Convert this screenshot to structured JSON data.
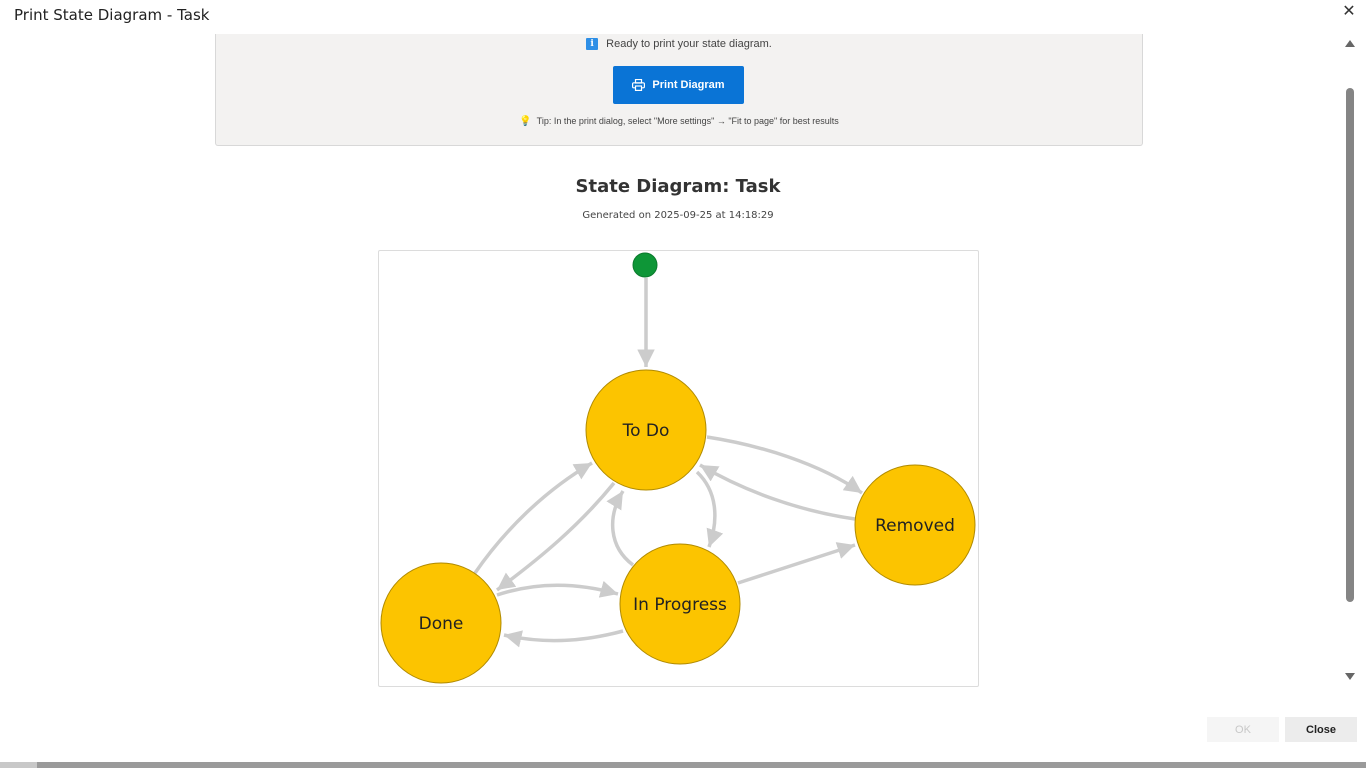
{
  "window": {
    "title": "Print State Diagram - Task",
    "close_glyph": "✕"
  },
  "print_panel": {
    "info_icon": "info-icon",
    "info_glyph": "i",
    "ready_text": "Ready to print your state diagram.",
    "print_button_label": "Print Diagram",
    "print_icon": "printer-icon",
    "tip_icon": "lightbulb-icon",
    "tip_glyph": "💡",
    "tip_text": "Tip: In the print dialog, select \"More settings\" → \"Fit to page\" for best results"
  },
  "diagram": {
    "title": "State Diagram: Task",
    "generated": "Generated on 2025-09-25 at 14:18:29",
    "initial_color": "#0e9637",
    "state_color": "#fcc400",
    "edge_color": "#cccccc",
    "states": [
      "To Do",
      "In Progress",
      "Done",
      "Removed"
    ],
    "transitions": [
      {
        "from": "Start",
        "to": "To Do"
      },
      {
        "from": "To Do",
        "to": "Removed"
      },
      {
        "from": "Removed",
        "to": "To Do"
      },
      {
        "from": "To Do",
        "to": "In Progress"
      },
      {
        "from": "In Progress",
        "to": "To Do"
      },
      {
        "from": "To Do",
        "to": "Done"
      },
      {
        "from": "Done",
        "to": "To Do"
      },
      {
        "from": "Done",
        "to": "In Progress"
      },
      {
        "from": "In Progress",
        "to": "Done"
      },
      {
        "from": "In Progress",
        "to": "Removed"
      }
    ]
  },
  "footer": {
    "ok_label": "OK",
    "close_label": "Close"
  }
}
